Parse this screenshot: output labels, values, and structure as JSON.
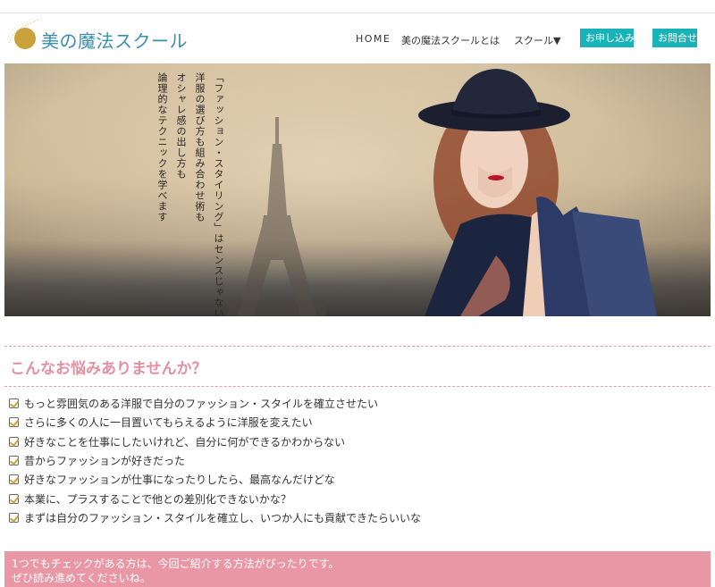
{
  "brand": {
    "name": "美の魔法スクール"
  },
  "nav": {
    "home": "HOME",
    "about": "美の魔法スクールとは",
    "school": "スクール▼",
    "apply": "お申し込み",
    "contact": "お問合せ"
  },
  "hero": {
    "lines": [
      "「ファッション・スタイリング」はセンスじゃない",
      "洋服の選び方も組み合わせ術も",
      "オシャレ感の出し方も",
      "論理的なテクニックを学べます"
    ]
  },
  "worries": {
    "title": "こんなお悩みありませんか？",
    "items": [
      "もっと雰囲気のある洋服で自分のファッション・スタイルを確立させたい",
      "さらに多くの人に一目置いてもらえるように洋服を変えたい",
      "好きなことを仕事にしたいけれど、自分に何ができるかわからない",
      "昔からファッションが好きだった",
      "好きなファッションが仕事になったりしたら、最高なんだけどな",
      "本業に、プラスすることで他との差別化できないかな？",
      "まずは自分のファッション・スタイルを確立し、いつか人にも貢献できたらいいな"
    ]
  },
  "banner": {
    "line1": "1つでもチェックがある方は、今回ご紹介する方法がぴったりです。",
    "line2": "ぜひ読み進めてくださいね。"
  },
  "colors": {
    "accent_pink": "#e58fa2",
    "banner_pink": "#ea97a5",
    "button_teal": "#17b3b8",
    "logo_blue": "#3a8fb0",
    "logo_gold": "#c9a23b"
  }
}
